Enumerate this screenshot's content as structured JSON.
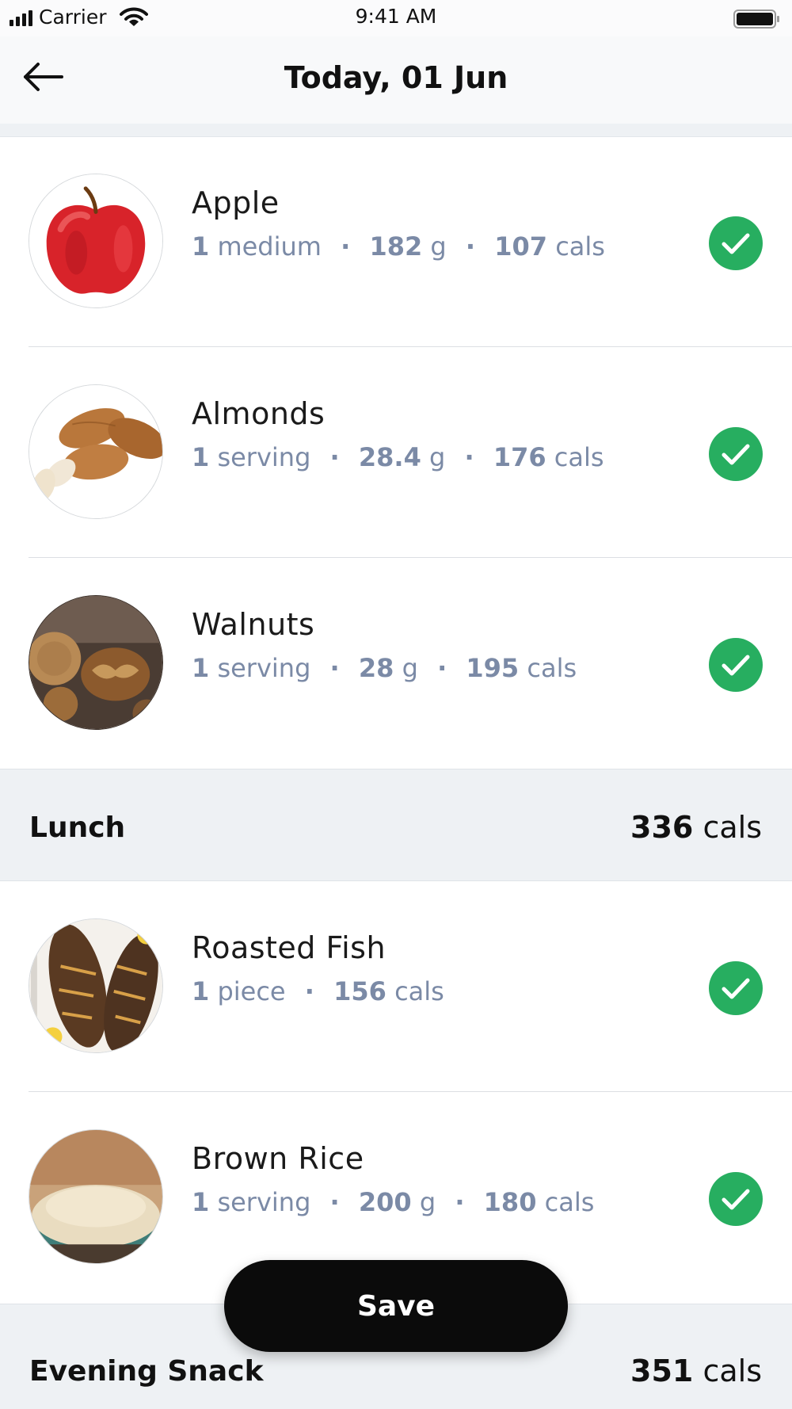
{
  "status_bar": {
    "carrier": "Carrier",
    "time": "9:41 AM"
  },
  "header": {
    "title": "Today, 01 Jun",
    "back_icon": "arrow-left-icon"
  },
  "colors": {
    "check_green": "#27ae60",
    "meta_text": "#7b8aa6",
    "section_bg": "#eef1f4",
    "button_bg": "#0b0b0b"
  },
  "foods_top": [
    {
      "name": "Apple",
      "amount": "1",
      "unit": "medium",
      "weight": "182",
      "weight_unit": "g",
      "cals": "107",
      "cals_unit": "cals",
      "image": "apple-image",
      "checked": true
    },
    {
      "name": "Almonds",
      "amount": "1",
      "unit": "serving",
      "weight": "28.4",
      "weight_unit": "g",
      "cals": "176",
      "cals_unit": "cals",
      "image": "almonds-image",
      "checked": true
    },
    {
      "name": "Walnuts",
      "amount": "1",
      "unit": "serving",
      "weight": "28",
      "weight_unit": "g",
      "cals": "195",
      "cals_unit": "cals",
      "image": "walnuts-image",
      "checked": true
    }
  ],
  "lunch": {
    "title": "Lunch",
    "cals": "336",
    "cals_unit": "cals",
    "items": [
      {
        "name": "Roasted Fish",
        "amount": "1",
        "unit": "piece",
        "cals": "156",
        "cals_unit": "cals",
        "image": "roasted-fish-image",
        "checked": true
      },
      {
        "name": "Brown Rice",
        "amount": "1",
        "unit": "serving",
        "weight": "200",
        "weight_unit": "g",
        "cals": "180",
        "cals_unit": "cals",
        "image": "brown-rice-image",
        "checked": true
      }
    ]
  },
  "evening_snack": {
    "title": "Evening Snack",
    "cals": "351",
    "cals_unit": "cals"
  },
  "save_label": "Save"
}
